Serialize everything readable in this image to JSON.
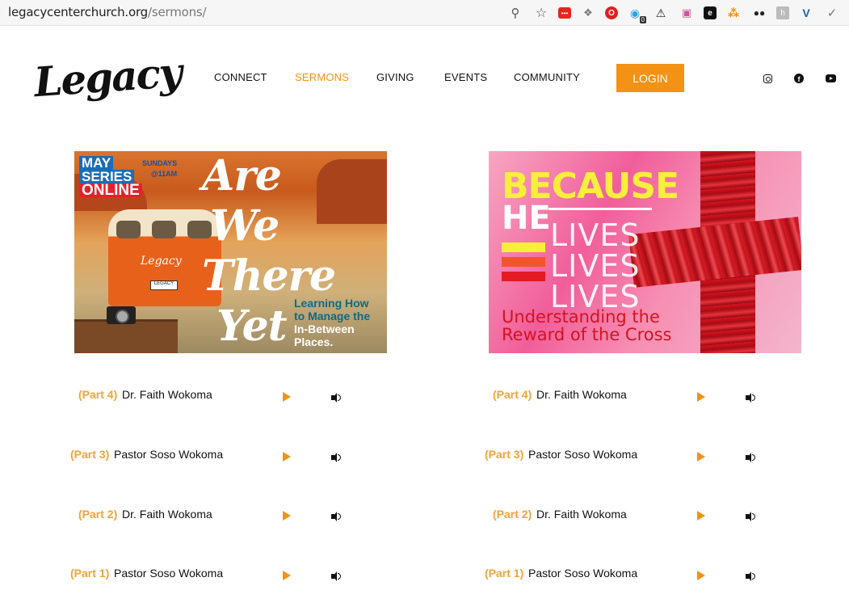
{
  "browser": {
    "url_domain": "legacycenterchurch.org",
    "url_path": "/sermons/",
    "icons": [
      "zoom-icon",
      "bookmark-star-icon",
      "red-extension-icon",
      "dropbox-icon",
      "opera-icon",
      "ghostery-icon",
      "warning-icon",
      "sheet-icon",
      "black-extension-icon",
      "orange-extension-icon",
      "mask-icon",
      "grey-extension-icon",
      "vimeo-icon",
      "check-icon"
    ],
    "ghostery_badge": "0"
  },
  "header": {
    "logo_text": "Legacy",
    "nav": [
      {
        "label": "CONNECT",
        "active": false
      },
      {
        "label": "SERMONS",
        "active": true
      },
      {
        "label": "GIVING",
        "active": false
      },
      {
        "label": "EVENTS",
        "active": false
      },
      {
        "label": "COMMUNITY",
        "active": false
      }
    ],
    "login_label": "LOGIN",
    "social": [
      "instagram-icon",
      "facebook-icon",
      "youtube-icon"
    ]
  },
  "series_left": {
    "badge_line1": "MAY",
    "badge_line2": "SERIES",
    "badge_line3": "ONLINE",
    "schedule_line1": "SUNDAYS",
    "schedule_line2": "@11AM",
    "title_words": [
      "Are",
      "We",
      "There",
      "Yet"
    ],
    "subtitle_line1": "Learning How",
    "subtitle_line2": "to Manage the",
    "subtitle_line3": "In-Between",
    "subtitle_line4": "Places.",
    "van_logo": "Legacy",
    "van_plate": "LEGACY",
    "sermons": [
      {
        "part": "(Part 4)",
        "speaker": "Dr. Faith Wokoma"
      },
      {
        "part": "(Part 3)",
        "speaker": "Pastor Soso Wokoma"
      },
      {
        "part": "(Part 2)",
        "speaker": "Dr. Faith Wokoma"
      },
      {
        "part": "(Part 1)",
        "speaker": "Pastor Soso Wokoma"
      }
    ]
  },
  "series_right": {
    "title_line1": "BECAUSE",
    "title_line2": "HE",
    "lives": [
      "LIVES",
      "LIVES",
      "LIVES"
    ],
    "subtitle_line1": "Understanding the",
    "subtitle_line2": "Reward of the Cross",
    "sermons": [
      {
        "part": "(Part 4)",
        "speaker": "Dr. Faith Wokoma"
      },
      {
        "part": "(Part 3)",
        "speaker": "Pastor Soso Wokoma"
      },
      {
        "part": "(Part 2)",
        "speaker": "Dr. Faith Wokoma"
      },
      {
        "part": "(Part 1)",
        "speaker": "Pastor Soso Wokoma"
      }
    ]
  },
  "colors": {
    "accent": "#f39214",
    "text": "#111111"
  }
}
